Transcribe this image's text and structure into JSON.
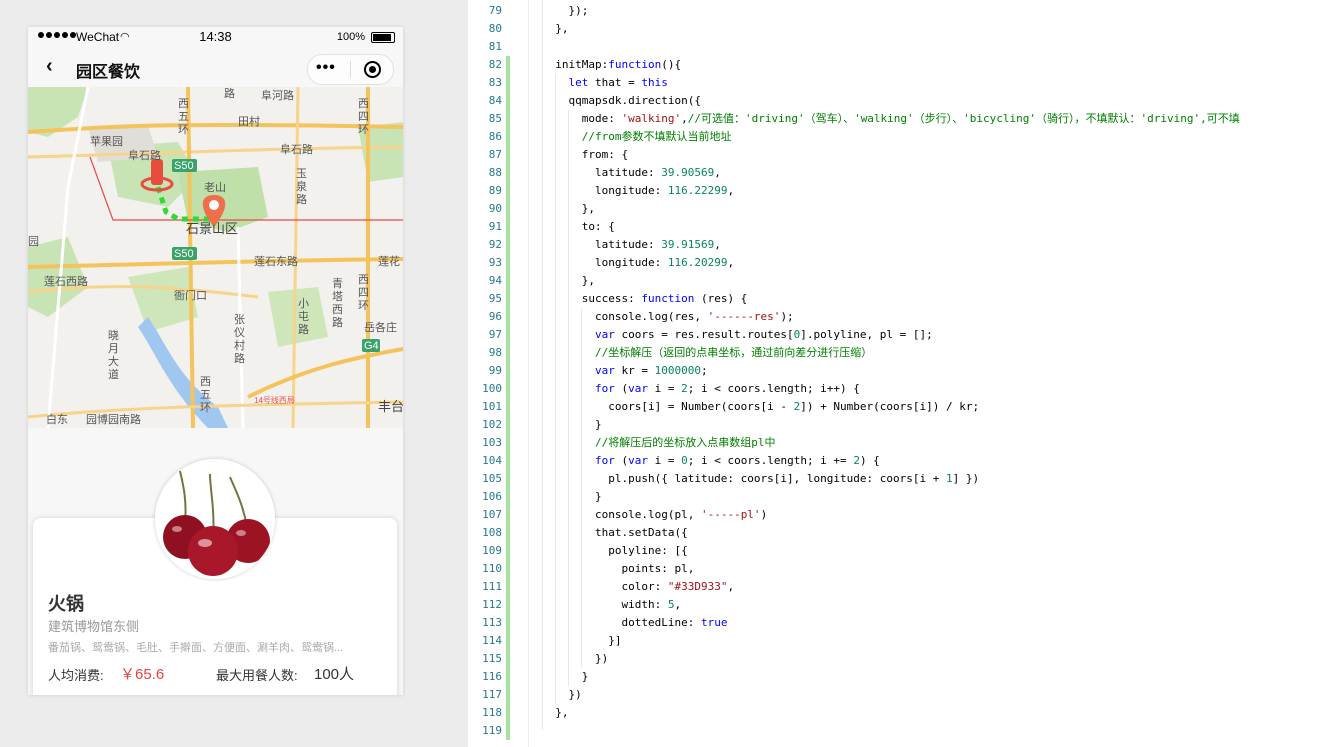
{
  "simulator": {
    "status_bar": {
      "carrier": "WeChat",
      "time": "14:38",
      "battery": "100%"
    },
    "nav": {
      "back_icon": "chevron-left-icon",
      "title": "园区餐饮",
      "more_icon": "more-dots-icon",
      "close_icon": "target-circle-icon"
    },
    "map": {
      "labels": [
        {
          "text": "路"
        },
        {
          "text": "阜河路"
        },
        {
          "text": "西五环"
        },
        {
          "text": "田村"
        },
        {
          "text": "西四环"
        },
        {
          "text": "苹果园"
        },
        {
          "text": "阜石路"
        },
        {
          "text": "S50"
        },
        {
          "text": "阜石路"
        },
        {
          "text": "玉泉路"
        },
        {
          "text": "老山"
        },
        {
          "text": "石景山区"
        },
        {
          "text": "园"
        },
        {
          "text": "S50"
        },
        {
          "text": "莲石东路"
        },
        {
          "text": "莲花"
        },
        {
          "text": "莲石西路"
        },
        {
          "text": "衙门口"
        },
        {
          "text": "青塔西路"
        },
        {
          "text": "西四环"
        },
        {
          "text": "张仪村路"
        },
        {
          "text": "小屯路"
        },
        {
          "text": "岳各庄"
        },
        {
          "text": "G4"
        },
        {
          "text": "晓月大道"
        },
        {
          "text": "西五环"
        },
        {
          "text": "丰台"
        },
        {
          "text": "白东"
        },
        {
          "text": "园博园南路"
        },
        {
          "text": "14号线西局"
        }
      ],
      "route_color": "#33D933",
      "marker_color": "#e74c3c"
    },
    "card": {
      "name": "火锅",
      "address": "建筑博物馆东侧",
      "menu": "番茄锅、鸳鸯锅、毛肚、手擀面、方便面、涮羊肉、鸳鸯锅...",
      "price_label": "人均消费:",
      "price_value": "￥65.6",
      "capacity_label": "最大用餐人数:",
      "capacity_value": "100人",
      "accent": "#e64340"
    }
  },
  "editor": {
    "lines": [
      {
        "n": "79",
        "t": "    });"
      },
      {
        "n": "80",
        "t": "  },"
      },
      {
        "n": "81",
        "t": ""
      },
      {
        "n": "82",
        "t": "  initMap:function(){"
      },
      {
        "n": "83",
        "t": "    let that = this"
      },
      {
        "n": "84",
        "t": "    qqmapsdk.direction({"
      },
      {
        "n": "85",
        "t": "      mode: 'walking',//可选值：'driving'（驾车）、'walking'（步行）、'bicycling'（骑行），不填默认：'driving',可不填"
      },
      {
        "n": "86",
        "t": "      //from参数不填默认当前地址"
      },
      {
        "n": "87",
        "t": "      from: {"
      },
      {
        "n": "88",
        "t": "        latitude: 39.90569,"
      },
      {
        "n": "89",
        "t": "        longitude: 116.22299,"
      },
      {
        "n": "90",
        "t": "      },"
      },
      {
        "n": "91",
        "t": "      to: {"
      },
      {
        "n": "92",
        "t": "        latitude: 39.91569,"
      },
      {
        "n": "93",
        "t": "        longitude: 116.20299,"
      },
      {
        "n": "94",
        "t": "      },"
      },
      {
        "n": "95",
        "t": "      success: function (res) {"
      },
      {
        "n": "96",
        "t": "        console.log(res, '------res');"
      },
      {
        "n": "97",
        "t": "        var coors = res.result.routes[0].polyline, pl = [];"
      },
      {
        "n": "98",
        "t": "        //坐标解压（返回的点串坐标，通过前向差分进行压缩）"
      },
      {
        "n": "99",
        "t": "        var kr = 1000000;"
      },
      {
        "n": "100",
        "t": "        for (var i = 2; i < coors.length; i++) {"
      },
      {
        "n": "101",
        "t": "          coors[i] = Number(coors[i - 2]) + Number(coors[i]) / kr;"
      },
      {
        "n": "102",
        "t": "        }"
      },
      {
        "n": "103",
        "t": "        //将解压后的坐标放入点串数组pl中"
      },
      {
        "n": "104",
        "t": "        for (var i = 0; i < coors.length; i += 2) {"
      },
      {
        "n": "105",
        "t": "          pl.push({ latitude: coors[i], longitude: coors[i + 1] })"
      },
      {
        "n": "106",
        "t": "        }"
      },
      {
        "n": "107",
        "t": "        console.log(pl, '-----pl')"
      },
      {
        "n": "108",
        "t": "        that.setData({"
      },
      {
        "n": "109",
        "t": "          polyline: [{"
      },
      {
        "n": "110",
        "t": "            points: pl,"
      },
      {
        "n": "111",
        "t": "            color: \"#33D933\","
      },
      {
        "n": "112",
        "t": "            width: 5,"
      },
      {
        "n": "113",
        "t": "            dottedLine: true"
      },
      {
        "n": "114",
        "t": "          }]"
      },
      {
        "n": "115",
        "t": "        })"
      },
      {
        "n": "116",
        "t": "      }"
      },
      {
        "n": "117",
        "t": "    })"
      },
      {
        "n": "118",
        "t": "  },"
      },
      {
        "n": "119",
        "t": ""
      }
    ]
  }
}
